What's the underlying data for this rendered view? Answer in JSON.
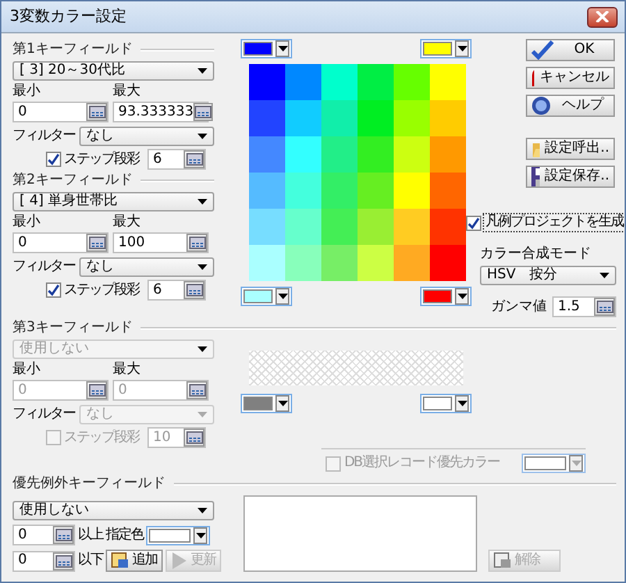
{
  "window": {
    "title": "3変数カラー設定"
  },
  "key_fields": [
    {
      "heading": "第1キーフィールド",
      "field": "[ 3] 20～30代比",
      "disabled": false,
      "min_label": "最小",
      "min": "0",
      "max_label": "最大",
      "max": "93.333333",
      "filter_label": "フィルター",
      "filter": "なし",
      "step_label": "ステップ段彩",
      "step_checked": true,
      "steps": "6"
    },
    {
      "heading": "第2キーフィールド",
      "field": "[ 4] 単身世帯比",
      "disabled": false,
      "min_label": "最小",
      "min": "0",
      "max_label": "最大",
      "max": "100",
      "filter_label": "フィルター",
      "filter": "なし",
      "step_label": "ステップ段彩",
      "step_checked": true,
      "steps": "6"
    },
    {
      "heading": "第3キーフィールド",
      "field": "使用しない",
      "disabled": true,
      "min_label": "最小",
      "min": "0",
      "max_label": "最大",
      "max": "0",
      "filter_label": "フィルター",
      "filter": "なし",
      "step_label": "ステップ段彩",
      "step_checked": false,
      "steps": "10"
    }
  ],
  "color_preview": {
    "top_colors": [
      {
        "color": "#0000ff"
      },
      {
        "color": "#ffff00"
      }
    ],
    "rows": [
      [
        {
          "color": "#0000ff"
        },
        {
          "color": "#0088ff"
        },
        {
          "color": "#00ffcc"
        },
        {
          "color": "#00ee44"
        },
        {
          "color": "#66ff00"
        },
        {
          "color": "#ffff00"
        }
      ],
      [
        {
          "color": "#2244ff"
        },
        {
          "color": "#11ccff"
        },
        {
          "color": "#11eeaa"
        },
        {
          "color": "#00ee22"
        },
        {
          "color": "#99ff00"
        },
        {
          "color": "#ffcc00"
        }
      ],
      [
        {
          "color": "#4488ff"
        },
        {
          "color": "#33ffff"
        },
        {
          "color": "#22ee88"
        },
        {
          "color": "#33ee22"
        },
        {
          "color": "#ccff11"
        },
        {
          "color": "#ff9900"
        }
      ],
      [
        {
          "color": "#55bbff"
        },
        {
          "color": "#44ffdd"
        },
        {
          "color": "#33ee66"
        },
        {
          "color": "#66ee22"
        },
        {
          "color": "#ffff00"
        },
        {
          "color": "#ff6600"
        }
      ],
      [
        {
          "color": "#77ddff"
        },
        {
          "color": "#66ffcc"
        },
        {
          "color": "#44ee55"
        },
        {
          "color": "#99ee33"
        },
        {
          "color": "#ffcc22"
        },
        {
          "color": "#ff3300"
        }
      ],
      [
        {
          "color": "#aaffff"
        },
        {
          "color": "#88ffbb"
        },
        {
          "color": "#77ee66"
        },
        {
          "color": "#ccff44"
        },
        {
          "color": "#ffaa22"
        },
        {
          "color": "#ff0000"
        }
      ]
    ],
    "bottom_colors": [
      {
        "color": "#aaffff"
      },
      {
        "color": "#ff0000"
      }
    ]
  },
  "third_preview": {
    "bottom_colors": [
      {
        "color": "#808080"
      },
      {
        "color": "#ffffff"
      }
    ]
  },
  "buttons": [
    {
      "label": "OK",
      "kind": "ok"
    },
    {
      "label": "キャンセル",
      "kind": "cancel"
    },
    {
      "label": "ヘルプ",
      "kind": "help"
    },
    {
      "label": "設定呼出..",
      "kind": "load"
    },
    {
      "label": "設定保存..",
      "kind": "save"
    }
  ],
  "legend": {
    "label": "凡例プロジェクトを生成",
    "checked": true
  },
  "blend": {
    "label": "カラー合成モード",
    "value": "HSV　按分"
  },
  "gamma": {
    "label": "ガンマ値",
    "value": "1.5"
  },
  "db_priority": {
    "label": "DB選択レコード優先カラー",
    "checked": false,
    "disabled": true,
    "color": "#ffffff"
  },
  "exception": {
    "heading": "優先例外キーフィールド",
    "field": "使用しない",
    "lower": "0",
    "lower_label": "以上",
    "upper": "0",
    "upper_label": "以下",
    "color_label": "指定色",
    "color": "#ffffff",
    "add": "追加",
    "update": "更新",
    "update_disabled": true,
    "remove": "解除",
    "remove_disabled": true
  }
}
